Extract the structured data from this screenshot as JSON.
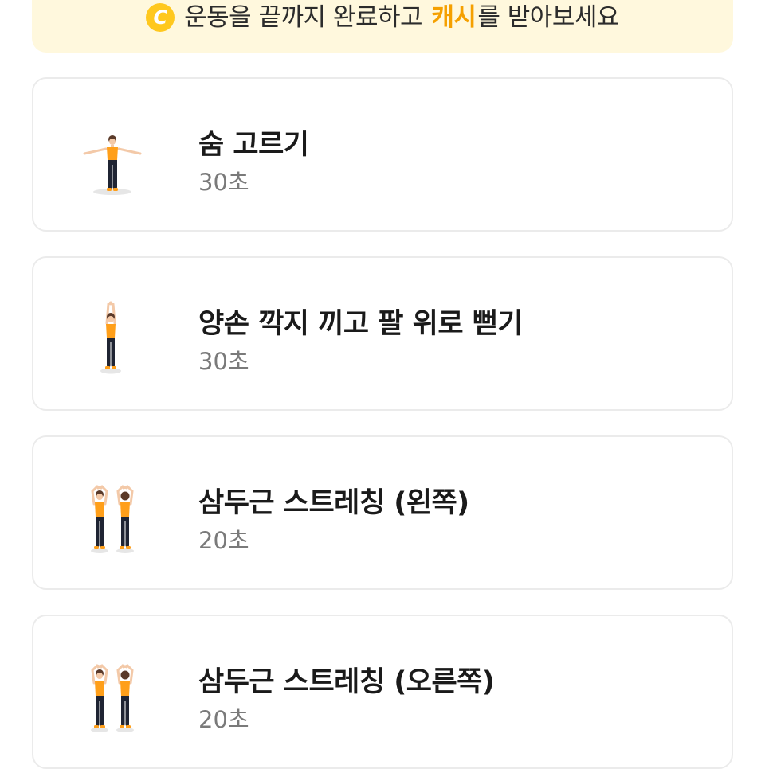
{
  "banner": {
    "coin_icon": "cash-coin-icon",
    "coin_letter": "C",
    "text_before": "운동을 끝까지 완료하고 ",
    "highlight": "캐시",
    "text_after": "를 받아보세요",
    "colors": {
      "background": "#fff8dd",
      "coin": "#ffc81e",
      "highlight": "#f5a000"
    }
  },
  "exercises": [
    {
      "title": "숨 고르기",
      "duration": "30초",
      "illustration": "arms-out-breathing-figure"
    },
    {
      "title": "양손 깍지 끼고 팔 위로 뻗기",
      "duration": "30초",
      "illustration": "arms-overhead-stretch-figure"
    },
    {
      "title": "삼두근 스트레칭 (왼쪽)",
      "duration": "20초",
      "illustration": "triceps-stretch-front-back-figures"
    },
    {
      "title": "삼두근 스트레칭 (오른쪽)",
      "duration": "20초",
      "illustration": "triceps-stretch-front-back-figures"
    }
  ],
  "colors": {
    "figure_top": "#ff9f1a",
    "figure_pants": "#1f2433",
    "skin": "#f3c9a8",
    "shadow": "#e6e6e6"
  }
}
